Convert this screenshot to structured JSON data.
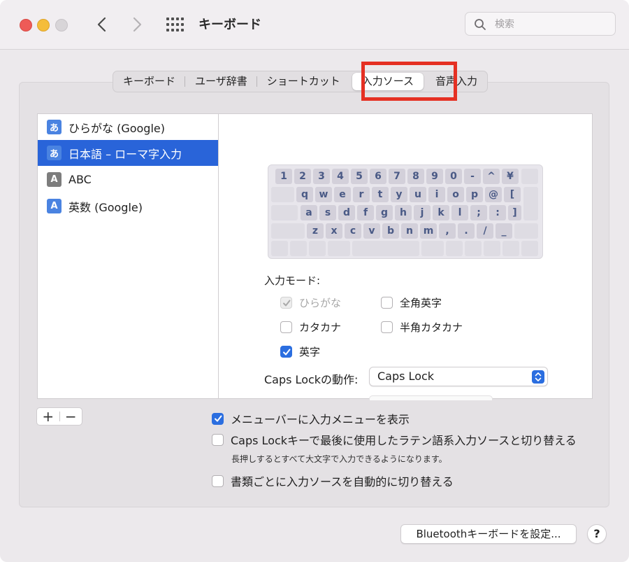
{
  "window": {
    "title": "キーボード"
  },
  "search": {
    "placeholder": "検索"
  },
  "tabs": [
    {
      "label": "キーボード"
    },
    {
      "label": "ユーザ辞書"
    },
    {
      "label": "ショートカット"
    },
    {
      "label": "入力ソース",
      "active": true
    },
    {
      "label": "音声入力"
    }
  ],
  "sources": [
    {
      "icon": "あ",
      "label": "ひらがな (Google)",
      "selected": false
    },
    {
      "icon": "あ",
      "label": "日本語 – ローマ字入力",
      "selected": true
    },
    {
      "icon": "A",
      "label": "ABC",
      "selected": false
    },
    {
      "icon": "A",
      "label": "英数 (Google)",
      "selected": false
    }
  ],
  "keyboard": {
    "row1": [
      "1",
      "2",
      "3",
      "4",
      "5",
      "6",
      "7",
      "8",
      "9",
      "0",
      "-",
      "^",
      "¥"
    ],
    "row2": [
      "q",
      "w",
      "e",
      "r",
      "t",
      "y",
      "u",
      "i",
      "o",
      "p",
      "@",
      "["
    ],
    "row3": [
      "a",
      "s",
      "d",
      "f",
      "g",
      "h",
      "j",
      "k",
      "l",
      ";",
      ":",
      "]"
    ],
    "row4": [
      "z",
      "x",
      "c",
      "v",
      "b",
      "n",
      "m",
      ",",
      ".",
      "/",
      "_"
    ]
  },
  "input_mode": {
    "label": "入力モード:",
    "options": [
      {
        "label": "ひらがな",
        "checked": true,
        "disabled": true
      },
      {
        "label": "全角英字",
        "checked": false,
        "disabled": false
      },
      {
        "label": "カタカナ",
        "checked": false,
        "disabled": false
      },
      {
        "label": "半角カタカナ",
        "checked": false,
        "disabled": false
      },
      {
        "label": "英字",
        "checked": true,
        "disabled": false
      }
    ]
  },
  "caps_lock": {
    "label": "Caps Lockの動作:",
    "value": "Caps Lock"
  },
  "list_buttons": {
    "add": "+",
    "remove": "−"
  },
  "options": [
    {
      "label": "メニューバーに入力メニューを表示",
      "checked": true
    },
    {
      "label": "Caps Lockキーで最後に使用したラテン語系入力ソースと切り替える",
      "checked": false
    },
    {
      "label": "書類ごとに入力ソースを自動的に切り替える",
      "checked": false
    }
  ],
  "caps_hint": "長押しするとすべて大文字で入力できるようになります。",
  "bluetooth_button": "Bluetoothキーボードを設定...",
  "help_button": "?",
  "colors": {
    "accent": "#2b6ee0",
    "selection": "#2964d9",
    "highlight": "#e53023"
  }
}
